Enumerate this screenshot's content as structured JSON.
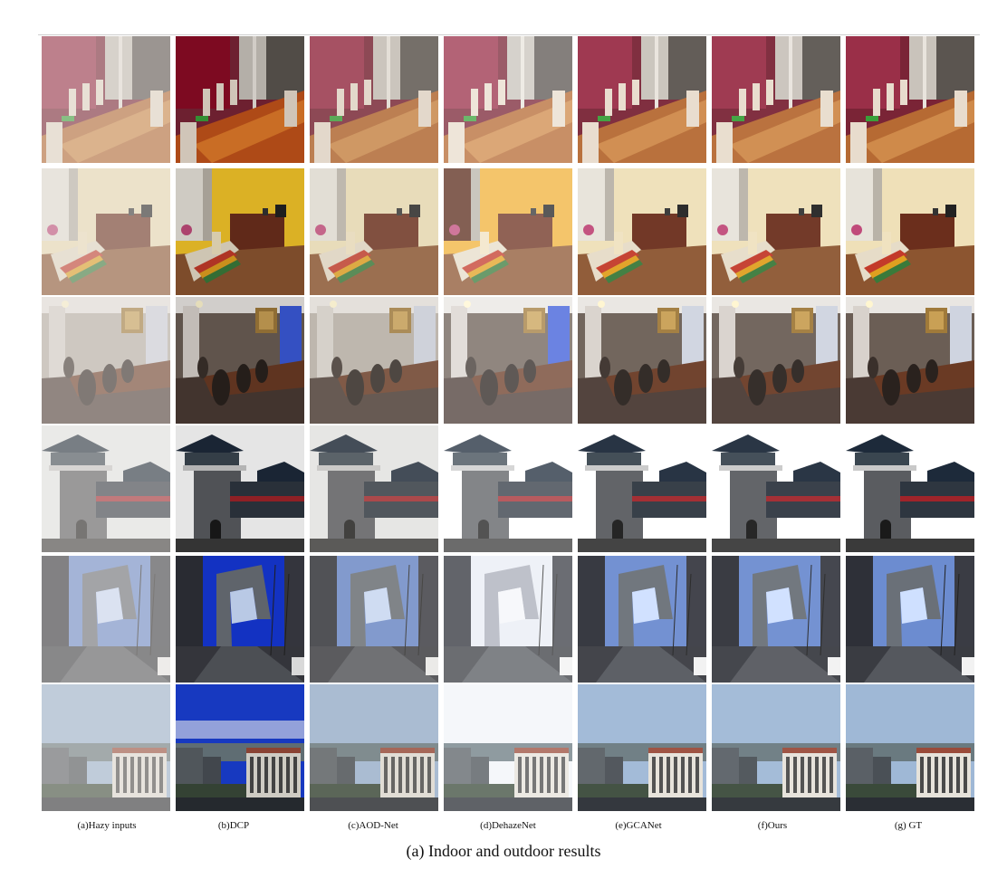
{
  "figure": {
    "caption": "(a)  Indoor and outdoor results",
    "column_labels": [
      "(a)Hazy inputs",
      "(b)DCP",
      "(c)AOD-Net",
      "(d)DehazeNet",
      "(e)GCANet",
      "(f)Ours",
      "(g) GT"
    ],
    "rows": [
      {
        "scene": "dining-room-red-wall"
      },
      {
        "scene": "dining-room-cream-wall"
      },
      {
        "scene": "dining-room-chandelier"
      },
      {
        "scene": "chinese-tower-building"
      },
      {
        "scene": "cctv-tower-street"
      },
      {
        "scene": "city-skyline-apartments"
      }
    ],
    "colors": {
      "hazy": "#d8d4cf",
      "dcp_blue": "#1030d0",
      "brick": "#9a4b3a"
    }
  }
}
